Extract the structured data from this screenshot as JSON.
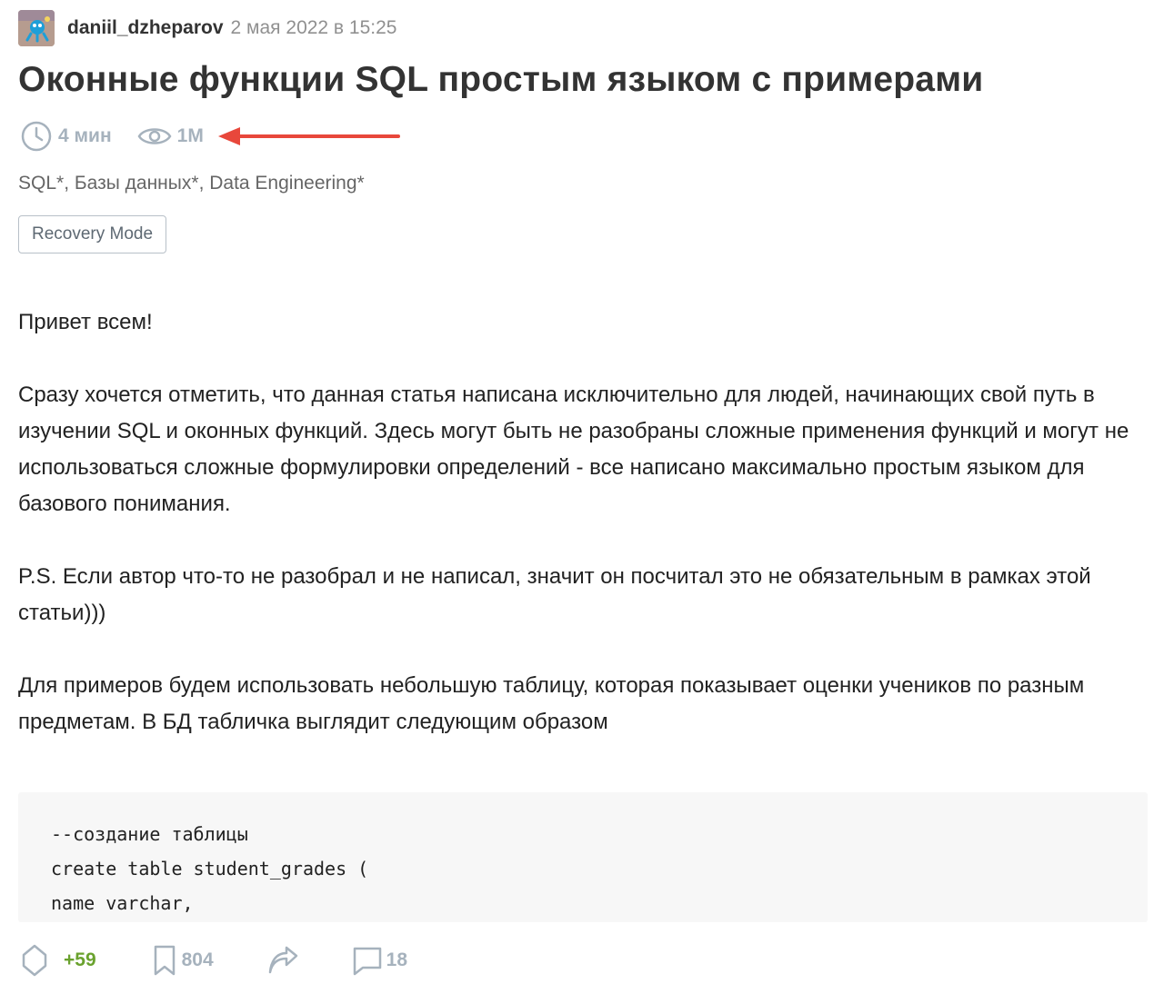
{
  "post": {
    "author": "daniil_dzheparov",
    "date": "2 мая 2022 в 15:25",
    "title": "Оконные функции SQL простым языком с примерами",
    "reading_time": "4 мин",
    "views": "1M",
    "hubs": [
      "SQL*",
      "Базы данных*",
      "Data Engineering*"
    ],
    "hub_separator": ", ",
    "badge": "Recovery Mode"
  },
  "body": {
    "paragraphs": [
      "Привет всем!",
      "Сразу хочется отметить, что данная статья написана исключительно для людей, начинающих свой путь в изучении SQL и оконных функций. Здесь могут быть не разобраны сложные применения функций и могут не использоваться сложные формулировки определений - все написано максимально простым языком для базового понимания.",
      "P.S. Если автор что-то не разобрал и не написал, значит он посчитал это не обязательным в рамках этой статьи)))",
      "Для примеров будем использовать небольшую таблицу, которая показывает оценки учеников по разным предметам. В БД табличка выглядит следующим образом"
    ],
    "code_lines": [
      "--создание таблицы",
      "create table student_grades (",
      "name varchar,"
    ]
  },
  "footer": {
    "score": "+59",
    "bookmarks": "804",
    "comments": "18"
  },
  "colors": {
    "accent_arrow": "#e8473b",
    "score_green": "#6aa22e",
    "icon_gray": "#a6b2bd"
  },
  "icons": {
    "clock": "clock-icon",
    "views": "eye-icon",
    "annotation": "red-arrow-icon",
    "vote": "vote-diamond-icon",
    "bookmark": "bookmark-icon",
    "share": "share-icon",
    "comments": "comment-icon"
  }
}
